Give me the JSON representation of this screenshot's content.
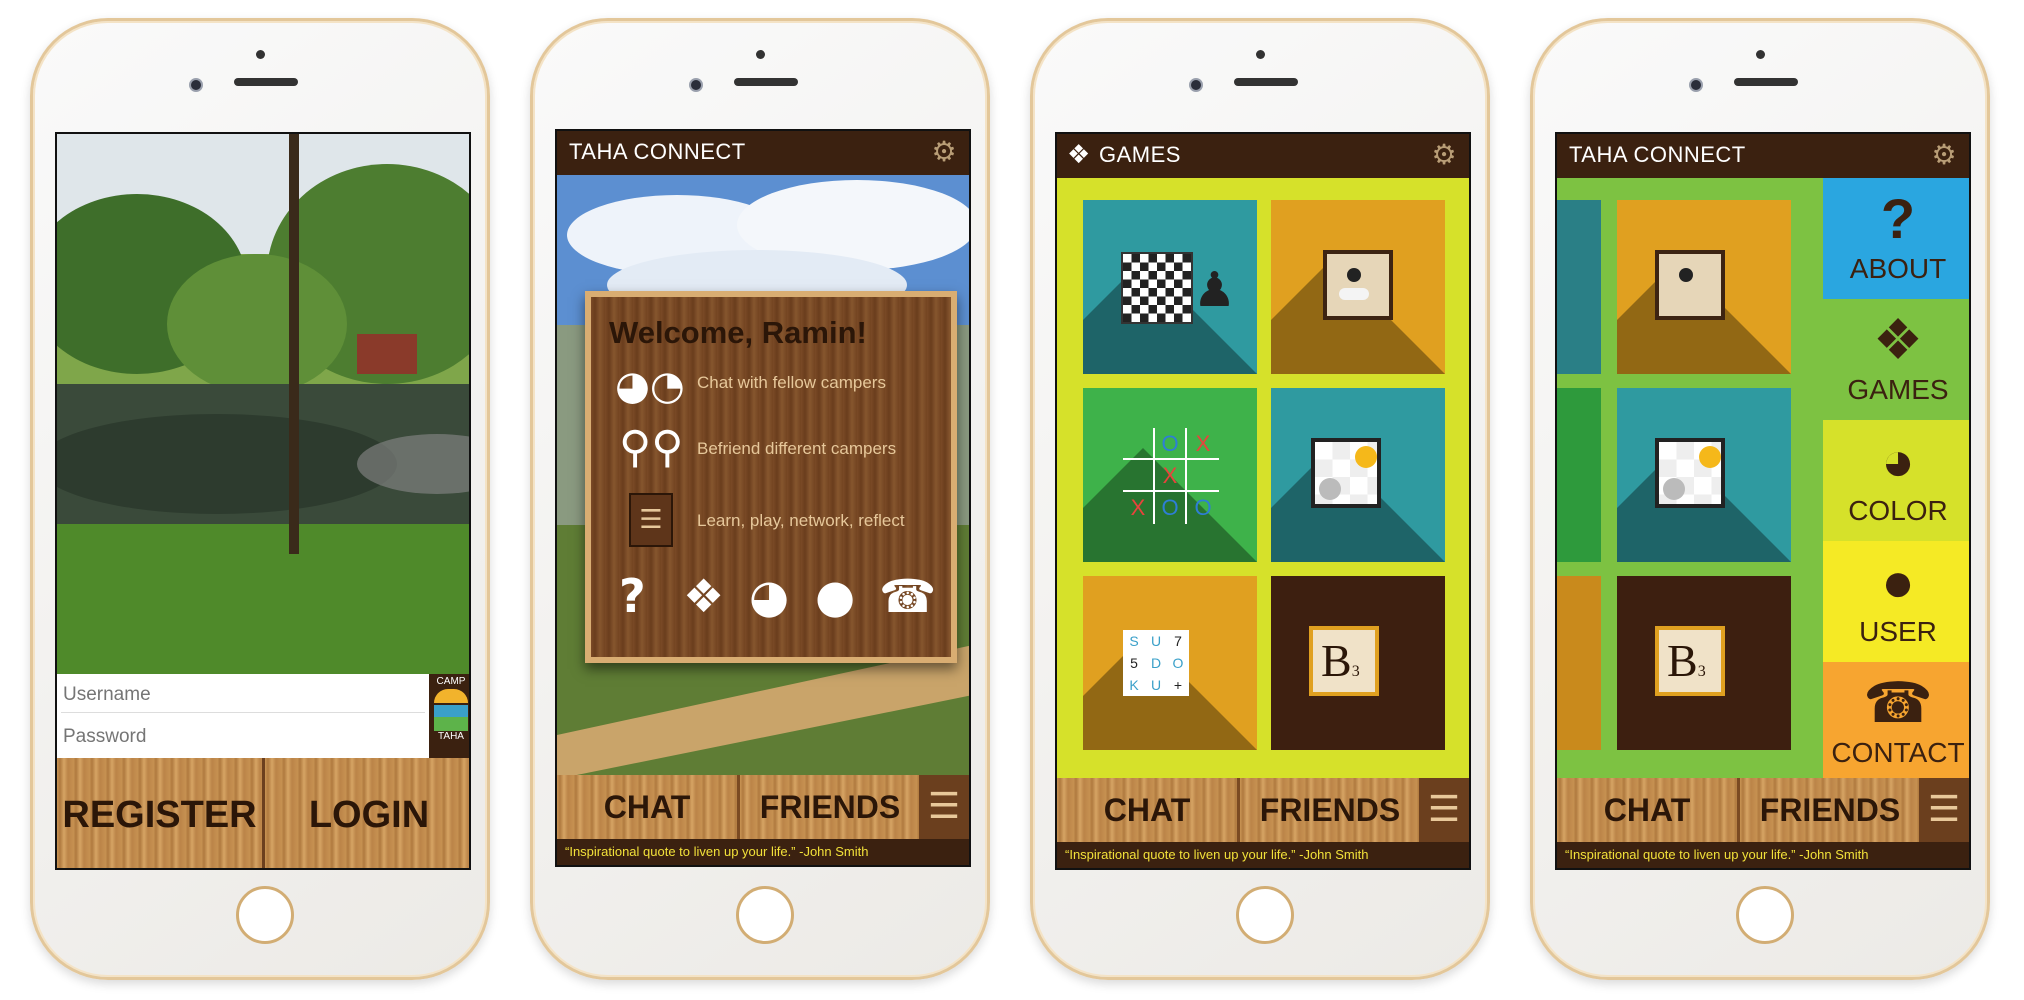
{
  "phone1": {
    "username_placeholder": "Username",
    "password_placeholder": "Password",
    "logo_top": "CAMP",
    "logo_bottom": "TAHA",
    "register_label": "REGISTER",
    "login_label": "LOGIN"
  },
  "phone2": {
    "title": "TAHA CONNECT",
    "welcome": "Welcome, Ramin!",
    "line1": "Chat with fellow campers",
    "line2": "Befriend different campers",
    "line3": "Learn, play, network, reflect",
    "chat_label": "CHAT",
    "friends_label": "FRIENDS",
    "menu_icon": "☰",
    "quote": "“Inspirational quote to liven up your life.” -John Smith",
    "icons": {
      "help": "?",
      "puzzle": "❖",
      "palette": "◕",
      "user": "●",
      "phone": "☎"
    }
  },
  "phone3": {
    "title": "GAMES",
    "chat_label": "CHAT",
    "friends_label": "FRIENDS",
    "menu_icon": "☰",
    "quote": "“Inspirational quote to liven up your life.” -John Smith",
    "sudoku": [
      "S",
      "U",
      "7",
      "5",
      "D",
      "O",
      "K",
      "U",
      "+"
    ],
    "scrabble_letter": "B",
    "scrabble_sub": "3",
    "tictactoe": [
      "",
      "O",
      "X",
      "",
      "X",
      "",
      "X",
      "O",
      "O"
    ],
    "colors": {
      "bg": "#d6e12a",
      "teal": "#2f9aa0",
      "orange": "#e0a020",
      "green": "#3eb24a",
      "brown": "#3d1f10"
    }
  },
  "phone4": {
    "title": "TAHA CONNECT",
    "about": "ABOUT",
    "games": "GAMES",
    "color": "COLOR",
    "user": "USER",
    "contact": "CONTACT",
    "chat_label": "CHAT",
    "friends_label": "FRIENDS",
    "menu_icon": "☰",
    "quote": "“Inspirational quote to liven up your life.” -John Smith",
    "scrabble_letter": "B",
    "scrabble_sub": "3"
  }
}
